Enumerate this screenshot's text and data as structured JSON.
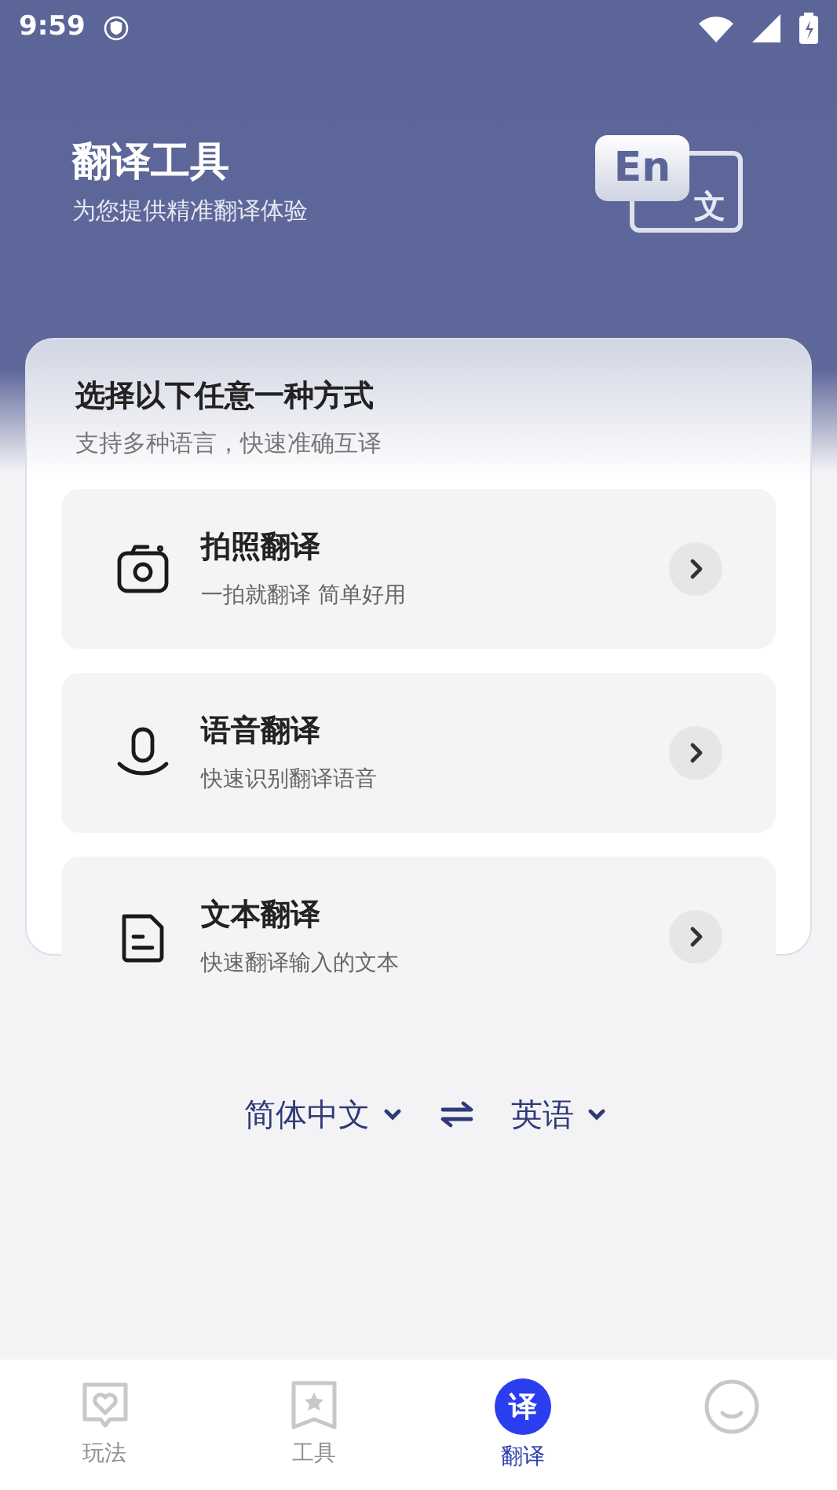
{
  "status_bar": {
    "time": "9:59"
  },
  "header": {
    "title": "翻译工具",
    "subtitle": "为您提供精准翻译体验",
    "logo_text": "En",
    "logo_char": "文"
  },
  "panel": {
    "title": "选择以下任意一种方式",
    "subtitle": "支持多种语言，快速准确互译"
  },
  "options": [
    {
      "kind": "camera",
      "title": "拍照翻译",
      "desc": "一拍就翻译 简单好用"
    },
    {
      "kind": "voice",
      "title": "语音翻译",
      "desc": "快速识别翻译语音"
    },
    {
      "kind": "text",
      "title": "文本翻译",
      "desc": "快速翻译输入的文本"
    }
  ],
  "languages": {
    "source": "简体中文",
    "target": "英语"
  },
  "tabs": [
    {
      "kind": "heart",
      "label": "玩法",
      "selected": false
    },
    {
      "kind": "star",
      "label": "工具",
      "selected": false
    },
    {
      "kind": "glyph",
      "glyph": "译",
      "label": "翻译",
      "selected": true
    },
    {
      "kind": "face",
      "selected": false
    }
  ]
}
